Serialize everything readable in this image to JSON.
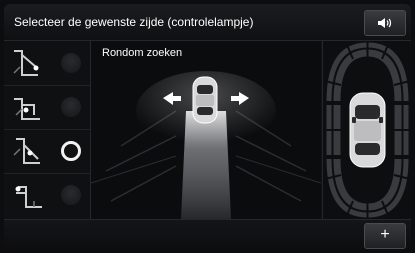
{
  "header": {
    "title": "Selecteer de gewenste zijde (controlelampje)",
    "volume_icon": "speaker-icon"
  },
  "sides": [
    {
      "icon": "car-front-left-sensor-icon",
      "led": "off"
    },
    {
      "icon": "car-rear-left-sensor-icon",
      "led": "off"
    },
    {
      "icon": "car-rear-right-sensor-icon",
      "led": "on"
    },
    {
      "icon": "car-front-right-sensor-icon",
      "led": "off"
    }
  ],
  "main": {
    "mode_label": "Rondom zoeken"
  },
  "footer": {
    "add_label": "+"
  },
  "colors": {
    "background": "#111214",
    "led_on": "#f2f2f2",
    "sensor_zone": "#3a3b3e"
  }
}
